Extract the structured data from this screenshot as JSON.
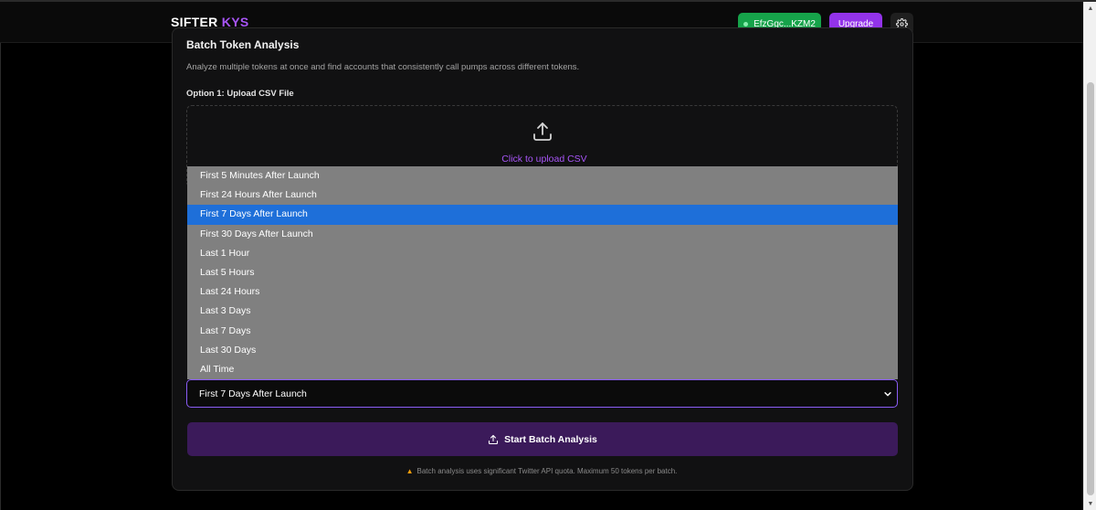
{
  "header": {
    "logo_main": "SIFTER",
    "logo_accent": "KYS",
    "wallet_label": "EfzGgc...KZM2",
    "upgrade_label": "Upgrade"
  },
  "card": {
    "title": "Batch Token Analysis",
    "description": "Analyze multiple tokens at once and find accounts that consistently call pumps across different tokens.",
    "option1_label": "Option 1: Upload CSV File",
    "upload_text": "Click to upload CSV"
  },
  "timeframe": {
    "selected": "First 7 Days After Launch",
    "options": [
      "First 5 Minutes After Launch",
      "First 24 Hours After Launch",
      "First 7 Days After Launch",
      "First 30 Days After Launch",
      "Last 1 Hour",
      "Last 5 Hours",
      "Last 24 Hours",
      "Last 3 Days",
      "Last 7 Days",
      "Last 30 Days",
      "All Time"
    ]
  },
  "actions": {
    "start_label": "Start Batch Analysis",
    "warning": "Batch analysis uses significant Twitter API quota. Maximum 50 tokens per batch."
  },
  "colors": {
    "accent": "#a855f7",
    "wallet": "#16a34a",
    "upgrade": "#9333ea",
    "selected_option": "#1e6fd9"
  }
}
